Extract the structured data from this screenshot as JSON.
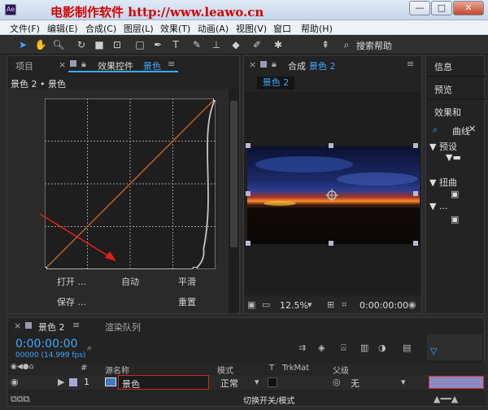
{
  "watermark": "电影制作软件  http://www.leawo.cn",
  "window_buttons": {
    "minimize": "—",
    "maximize": "□",
    "close": "✕"
  },
  "menu": [
    "文件(F)",
    "编辑(E)",
    "合成(C)",
    "图层(L)",
    "效果(T)",
    "动画(A)",
    "视图(V)",
    "窗口",
    "帮助(H)"
  ],
  "toolbar": {
    "search_label": "搜索帮助"
  },
  "left_panel": {
    "tab_project": "项目",
    "tab_effects_prefix": "效果控件",
    "tab_effects_layer": "景色",
    "breadcrumb": "景色 2 • 景色",
    "buttons": {
      "open": "打开 ...",
      "auto": "自动",
      "smooth": "平滑",
      "save": "保存 ...",
      "reset": "重置"
    },
    "curves": {
      "points": [
        [
          0,
          0
        ],
        [
          88,
          0
        ],
        [
          100,
          100
        ]
      ]
    }
  },
  "comp_panel": {
    "tab_label": "合成",
    "tab_comp": "景色 2",
    "comp_tag": "景色 2",
    "zoom": "12.5%",
    "timecode": "0:00:00:00"
  },
  "right_panel": {
    "info": "信息",
    "preview": "预览",
    "effects_tab": "效果和",
    "search_value": "曲线",
    "tree": [
      {
        "label": "▼ 预设"
      },
      {
        "label": "▼ 扭曲"
      },
      {
        "label": "▼ ..."
      }
    ]
  },
  "timeline": {
    "tab_comp": "景色 2",
    "tab_render": "渲染队列",
    "timecode": "0:00:00:00",
    "frame_info": "00000 (14.999 fps)",
    "columns": {
      "num": "#",
      "source_name": "源名称",
      "mode": "模式",
      "t": "T",
      "trkmat": "TrkMat",
      "parent": "父级"
    },
    "layer": {
      "index": "1",
      "name": "景色",
      "mode": "正常",
      "parent": "无"
    },
    "footer": "切换开关/模式"
  },
  "colors": {
    "accent_blue": "#3fa8ff",
    "watermark_red": "#d40000",
    "red_highlight": "#cc2a2a"
  }
}
